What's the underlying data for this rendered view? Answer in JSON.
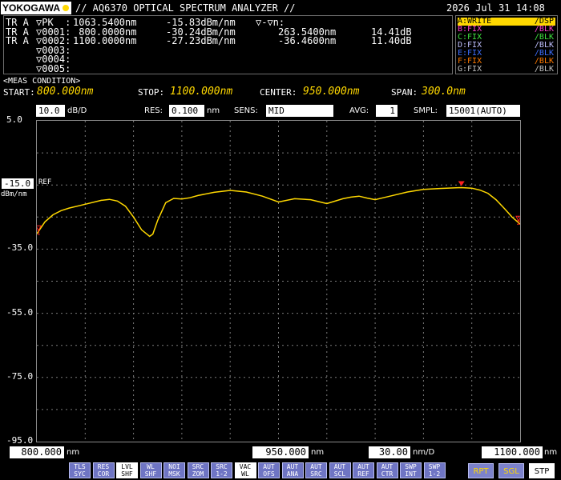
{
  "header": {
    "logo": "YOKOGAWA",
    "title": "// AQ6370 OPTICAL SPECTRUM ANALYZER //",
    "datetime": "2026 Jul 31 14:08"
  },
  "markers": {
    "rows": [
      {
        "prefix": "TR A",
        "name": "▽PK  :",
        "wl": "1063.5400nm",
        "lvl": "-15.83dBm/nm",
        "dwl": "▽-▽n:",
        "dlvl": ""
      },
      {
        "prefix": "TR A",
        "name": "▽0001:",
        "wl": " 800.0000nm",
        "lvl": "-30.24dBm/nm",
        "dwl": "263.5400nm",
        "dlvl": "14.41dB"
      },
      {
        "prefix": "TR A",
        "name": "▽0002:",
        "wl": "1100.0000nm",
        "lvl": "-27.23dBm/nm",
        "dwl": "-36.4600nm",
        "dlvl": "11.40dB"
      },
      {
        "prefix": "",
        "name": "▽0003:",
        "wl": "",
        "lvl": "",
        "dwl": "",
        "dlvl": ""
      },
      {
        "prefix": "",
        "name": "▽0004:",
        "wl": "",
        "lvl": "",
        "dwl": "",
        "dlvl": ""
      },
      {
        "prefix": "",
        "name": "▽0005:",
        "wl": "",
        "lvl": "",
        "dwl": "",
        "dlvl": ""
      }
    ]
  },
  "traces": [
    {
      "status": "A:WRITE",
      "mode": "/DSP",
      "color": "#ffd800",
      "active": true
    },
    {
      "status": "B:FIX",
      "mode": "/BLK",
      "color": "#ff3fd0",
      "active": false
    },
    {
      "status": "C:FIX",
      "mode": "/BLK",
      "color": "#3fe23f",
      "active": false
    },
    {
      "status": "D:FIX",
      "mode": "/BLK",
      "color": "#c0c0ff",
      "active": false
    },
    {
      "status": "E:FIX",
      "mode": "/BLK",
      "color": "#3f6fff",
      "active": false
    },
    {
      "status": "F:FIX",
      "mode": "/BLK",
      "color": "#ff7a00",
      "active": false
    },
    {
      "status": "G:FIX",
      "mode": "/BLK",
      "color": "#c0c0c0",
      "active": false
    }
  ],
  "meas": {
    "heading": "<MEAS CONDITION>",
    "start_label": "START:",
    "start_value": "800.000nm",
    "stop_label": "STOP:",
    "stop_value": "1100.000nm",
    "center_label": "CENTER:",
    "center_value": "950.000nm",
    "span_label": "SPAN:",
    "span_value": "300.0nm"
  },
  "settings": {
    "scale_value": "10.0",
    "scale_unit": "dB/D",
    "res_label": "RES:",
    "res_value": "0.100",
    "res_unit": "nm",
    "sens_label": "SENS:",
    "sens_value": "MID",
    "avg_label": "AVG:",
    "avg_value": "1",
    "smpl_label": "SMPL:",
    "smpl_value": "15001(AUTO)"
  },
  "chart_data": {
    "type": "line",
    "xlim": [
      800,
      1100
    ],
    "ylim": [
      -95,
      5
    ],
    "yticks": [
      "5.0",
      "-15.0",
      "-35.0",
      "-55.0",
      "-75.0",
      "-95.0"
    ],
    "ref_label": "REF",
    "y_unit": "dBm/nm",
    "grid": true,
    "series": [
      {
        "x": [
          800,
          805,
          810,
          815,
          820,
          830,
          840,
          845,
          850,
          855,
          860,
          865,
          870,
          872,
          875,
          880,
          885,
          890,
          895,
          900,
          910,
          920,
          930,
          940,
          950,
          960,
          970,
          980,
          990,
          995,
          1000,
          1005,
          1010,
          1015,
          1020,
          1030,
          1040,
          1050,
          1060,
          1063.54,
          1070,
          1075,
          1080,
          1085,
          1090,
          1095,
          1100
        ],
        "y": [
          -30.2,
          -26.5,
          -24.3,
          -23.0,
          -22.2,
          -21.0,
          -19.8,
          -19.5,
          -20.0,
          -21.6,
          -25.0,
          -29.0,
          -31.0,
          -30.3,
          -26.0,
          -20.5,
          -19.2,
          -19.4,
          -19.0,
          -18.3,
          -17.3,
          -16.7,
          -17.2,
          -18.5,
          -20.3,
          -19.3,
          -19.6,
          -20.8,
          -19.3,
          -18.8,
          -18.5,
          -19.1,
          -19.6,
          -19.0,
          -18.4,
          -17.2,
          -16.4,
          -16.1,
          -15.9,
          -15.83,
          -16.0,
          -16.6,
          -17.6,
          -19.6,
          -22.2,
          -25.0,
          -27.2
        ]
      }
    ],
    "markers": [
      {
        "label": "PK",
        "x": 1063.54,
        "y": -15.83
      },
      {
        "label": "1",
        "x": 800.0,
        "y": -30.24
      },
      {
        "label": "2",
        "x": 1100.0,
        "y": -27.23
      }
    ]
  },
  "xaxis": {
    "start": "800.000",
    "start_unit": "nm",
    "center": "950.000",
    "center_unit": "nm",
    "div": "30.00",
    "div_unit": "nm/D",
    "stop": "1100.000",
    "stop_unit": "nm"
  },
  "softkeys": [
    {
      "l1": "TLS",
      "l2": "SYC",
      "active": false
    },
    {
      "l1": "RES",
      "l2": "COR",
      "active": false
    },
    {
      "l1": "LVL",
      "l2": "SHF",
      "active": true
    },
    {
      "l1": "WL",
      "l2": "SHF",
      "active": false
    },
    {
      "l1": "NOI",
      "l2": "MSK",
      "active": false
    },
    {
      "l1": "SRC",
      "l2": "ZOM",
      "active": false
    },
    {
      "l1": "SRC",
      "l2": "1-2",
      "active": false
    },
    {
      "l1": "VAC",
      "l2": "WL",
      "active": true
    },
    {
      "l1": "AUT",
      "l2": "OFS",
      "active": false
    },
    {
      "l1": "AUT",
      "l2": "ANA",
      "active": false
    },
    {
      "l1": "AUT",
      "l2": "SRC",
      "active": false
    },
    {
      "l1": "AUT",
      "l2": "SCL",
      "active": false
    },
    {
      "l1": "AUT",
      "l2": "REF",
      "active": false
    },
    {
      "l1": "AUT",
      "l2": "CTR",
      "active": false
    },
    {
      "l1": "SWP",
      "l2": "INT",
      "active": false
    },
    {
      "l1": "SWP",
      "l2": "1-2",
      "active": false
    }
  ],
  "funckeys": [
    {
      "label": "RPT",
      "active": false
    },
    {
      "label": "SGL",
      "active": false
    },
    {
      "label": "STP",
      "active": true
    }
  ]
}
